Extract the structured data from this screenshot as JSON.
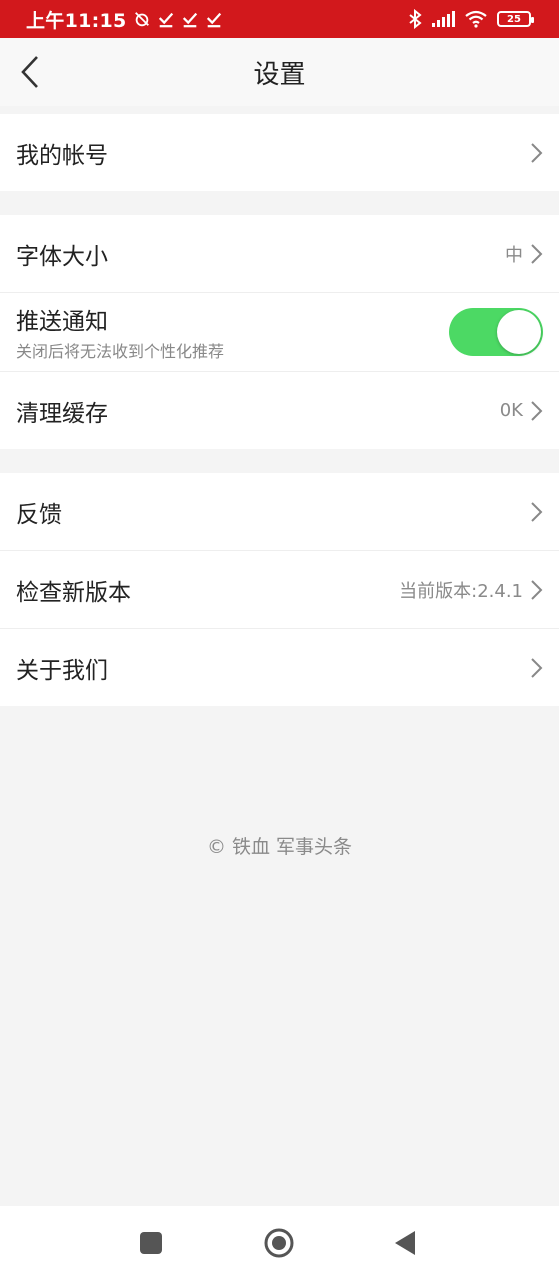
{
  "status_bar": {
    "time": "上午11:15",
    "battery": "25"
  },
  "header": {
    "title": "设置"
  },
  "settings": {
    "account": {
      "label": "我的帐号"
    },
    "font_size": {
      "label": "字体大小",
      "value": "中"
    },
    "push": {
      "label": "推送通知",
      "sublabel": "关闭后将无法收到个性化推荐",
      "enabled": true
    },
    "cache": {
      "label": "清理缓存",
      "value": "0K"
    },
    "feedback": {
      "label": "反馈"
    },
    "version": {
      "label": "检查新版本",
      "value": "当前版本:2.4.1"
    },
    "about": {
      "label": "关于我们"
    }
  },
  "footer": {
    "text": "© 铁血 军事头条"
  },
  "colors": {
    "status_bar": "#d2181c",
    "toggle_on": "#4cd964"
  }
}
